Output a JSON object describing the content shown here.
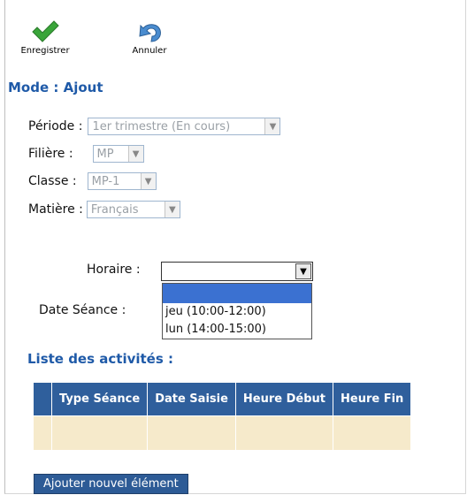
{
  "toolbar": {
    "save_label": "Enregistrer",
    "cancel_label": "Annuler"
  },
  "mode_title": "Mode : Ajout",
  "form": {
    "periode": {
      "label": "Période :",
      "value": "1er trimestre (En cours)"
    },
    "filiere": {
      "label": "Filière :",
      "value": "MP"
    },
    "classe": {
      "label": "Classe :",
      "value": "MP-1"
    },
    "matiere": {
      "label": "Matière :",
      "value": "Français"
    },
    "horaire": {
      "label": "Horaire :",
      "value": "",
      "options": [
        "",
        "jeu (10:00-12:00)",
        "lun (14:00-15:00)"
      ]
    },
    "date_seance": {
      "label": "Date Séance :"
    }
  },
  "activities": {
    "title": "Liste des activités :",
    "columns": [
      "Type Séance",
      "Date Saisie",
      "Heure Début",
      "Heure Fin"
    ]
  },
  "add_button_label": "Ajouter nouvel élément",
  "colors": {
    "accent_blue": "#1f5aa8",
    "header_blue": "#2f5f9c",
    "row_beige": "#f6eacb",
    "dropdown_highlight": "#3b71d1",
    "check_green": "#3aa53a"
  }
}
